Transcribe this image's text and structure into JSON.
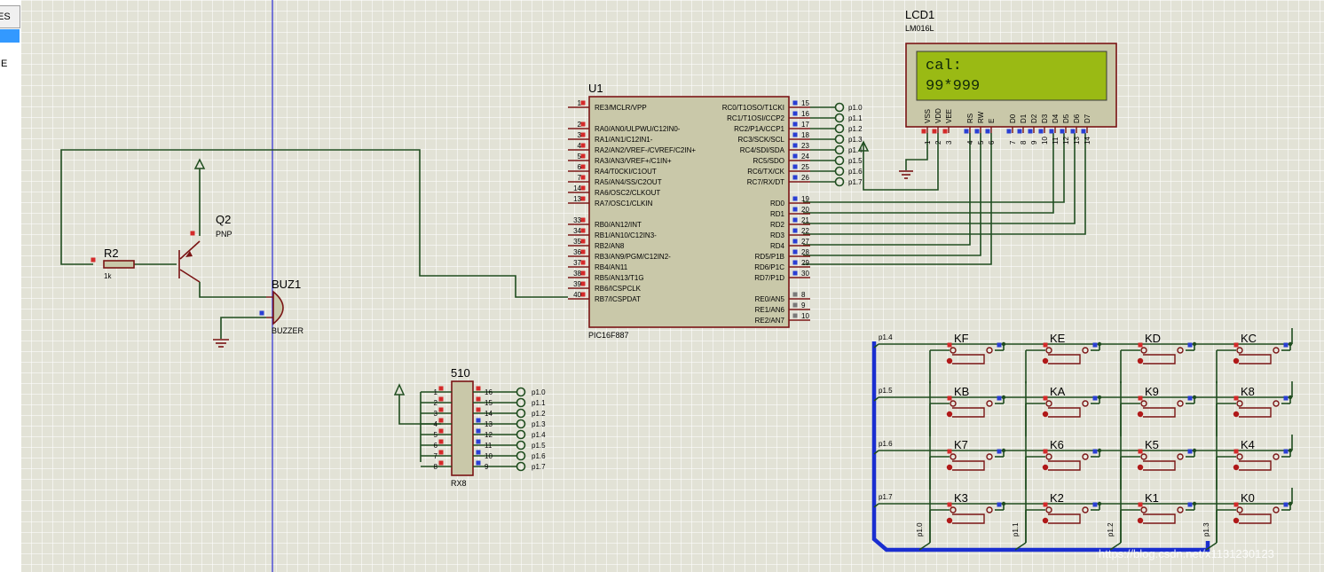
{
  "side_panel": {
    "header": "ES",
    "item": "IE"
  },
  "components": {
    "U1": {
      "ref": "U1",
      "part": "PIC16F887",
      "left_pins": [
        {
          "num": "1",
          "name": "RE3/MCLR/VPP"
        },
        {
          "num": "2",
          "name": "RA0/AN0/ULPWU/C12IN0-"
        },
        {
          "num": "3",
          "name": "RA1/AN1/C12IN1-"
        },
        {
          "num": "4",
          "name": "RA2/AN2/VREF-/CVREF/C2IN+"
        },
        {
          "num": "5",
          "name": "RA3/AN3/VREF+/C1IN+"
        },
        {
          "num": "6",
          "name": "RA4/T0CKI/C1OUT"
        },
        {
          "num": "7",
          "name": "RA5/AN4/SS/C2OUT"
        },
        {
          "num": "14",
          "name": "RA6/OSC2/CLKOUT"
        },
        {
          "num": "13",
          "name": "RA7/OSC1/CLKIN"
        },
        {
          "num": "33",
          "name": "RB0/AN12/INT"
        },
        {
          "num": "34",
          "name": "RB1/AN10/C12IN3-"
        },
        {
          "num": "35",
          "name": "RB2/AN8"
        },
        {
          "num": "36",
          "name": "RB3/AN9/PGM/C12IN2-"
        },
        {
          "num": "37",
          "name": "RB4/AN11"
        },
        {
          "num": "38",
          "name": "RB5/AN13/T1G"
        },
        {
          "num": "39",
          "name": "RB6/ICSPCLK"
        },
        {
          "num": "40",
          "name": "RB7/ICSPDAT"
        }
      ],
      "right_pins": [
        {
          "num": "15",
          "name": "RC0/T1OSO/T1CKI"
        },
        {
          "num": "16",
          "name": "RC1/T1OSI/CCP2"
        },
        {
          "num": "17",
          "name": "RC2/P1A/CCP1"
        },
        {
          "num": "18",
          "name": "RC3/SCK/SCL"
        },
        {
          "num": "23",
          "name": "RC4/SDI/SDA"
        },
        {
          "num": "24",
          "name": "RC5/SDO"
        },
        {
          "num": "25",
          "name": "RC6/TX/CK"
        },
        {
          "num": "26",
          "name": "RC7/RX/DT"
        },
        {
          "num": "19",
          "name": "RD0"
        },
        {
          "num": "20",
          "name": "RD1"
        },
        {
          "num": "21",
          "name": "RD2"
        },
        {
          "num": "22",
          "name": "RD3"
        },
        {
          "num": "27",
          "name": "RD4"
        },
        {
          "num": "28",
          "name": "RD5/P1B"
        },
        {
          "num": "29",
          "name": "RD6/P1C"
        },
        {
          "num": "30",
          "name": "RD7/P1D"
        },
        {
          "num": "8",
          "name": "RE0/AN5"
        },
        {
          "num": "9",
          "name": "RE1/AN6"
        },
        {
          "num": "10",
          "name": "RE2/AN7"
        }
      ],
      "port_labels": [
        "p1.0",
        "p1.1",
        "p1.2",
        "p1.3",
        "p1.4",
        "p1.5",
        "p1.6",
        "p1.7"
      ]
    },
    "LCD1": {
      "ref": "LCD1",
      "part": "LM016L",
      "line1": "cal:",
      "line2": "99*999",
      "pins": [
        {
          "num": "1",
          "name": "VSS"
        },
        {
          "num": "2",
          "name": "VDD"
        },
        {
          "num": "3",
          "name": "VEE"
        },
        {
          "num": "4",
          "name": "RS"
        },
        {
          "num": "5",
          "name": "RW"
        },
        {
          "num": "6",
          "name": "E"
        },
        {
          "num": "7",
          "name": "D0"
        },
        {
          "num": "8",
          "name": "D1"
        },
        {
          "num": "9",
          "name": "D2"
        },
        {
          "num": "10",
          "name": "D3"
        },
        {
          "num": "11",
          "name": "D4"
        },
        {
          "num": "12",
          "name": "D5"
        },
        {
          "num": "13",
          "name": "D6"
        },
        {
          "num": "14",
          "name": "D7"
        }
      ]
    },
    "Q2": {
      "ref": "Q2",
      "part": "PNP"
    },
    "R2": {
      "ref": "R2",
      "value": "1k"
    },
    "BUZ1": {
      "ref": "BUZ1",
      "part": "BUZZER"
    },
    "RX8": {
      "ref": "510",
      "part": "RX8",
      "left_pins": [
        "1",
        "2",
        "3",
        "4",
        "5",
        "6",
        "7",
        "8"
      ],
      "right_pins": [
        "16",
        "15",
        "14",
        "13",
        "12",
        "11",
        "10",
        "9"
      ],
      "port_labels": [
        "p1.0",
        "p1.1",
        "p1.2",
        "p1.3",
        "p1.4",
        "p1.5",
        "p1.6",
        "p1.7"
      ]
    },
    "keypad": {
      "rows": [
        {
          "port": "p1.4",
          "keys": [
            "KF",
            "KE",
            "KD",
            "KC"
          ]
        },
        {
          "port": "p1.5",
          "keys": [
            "KB",
            "KA",
            "K9",
            "K8"
          ]
        },
        {
          "port": "p1.6",
          "keys": [
            "K7",
            "K6",
            "K5",
            "K4"
          ]
        },
        {
          "port": "p1.7",
          "keys": [
            "K3",
            "K2",
            "K1",
            "K0"
          ]
        }
      ],
      "cols": [
        "p1.0",
        "p1.1",
        "p1.2",
        "p1.3"
      ]
    }
  },
  "watermark": "https://blog.csdn.net/x1131230123",
  "colors": {
    "canvas": "#e2e2d6",
    "wire": "#1f4d1f",
    "component": "#7a1414",
    "body_fill": "#c9c8a9",
    "bus": "#1a2ed0",
    "lcd_screen": "#9aba14",
    "cursor_line": "#2d2dd6"
  }
}
